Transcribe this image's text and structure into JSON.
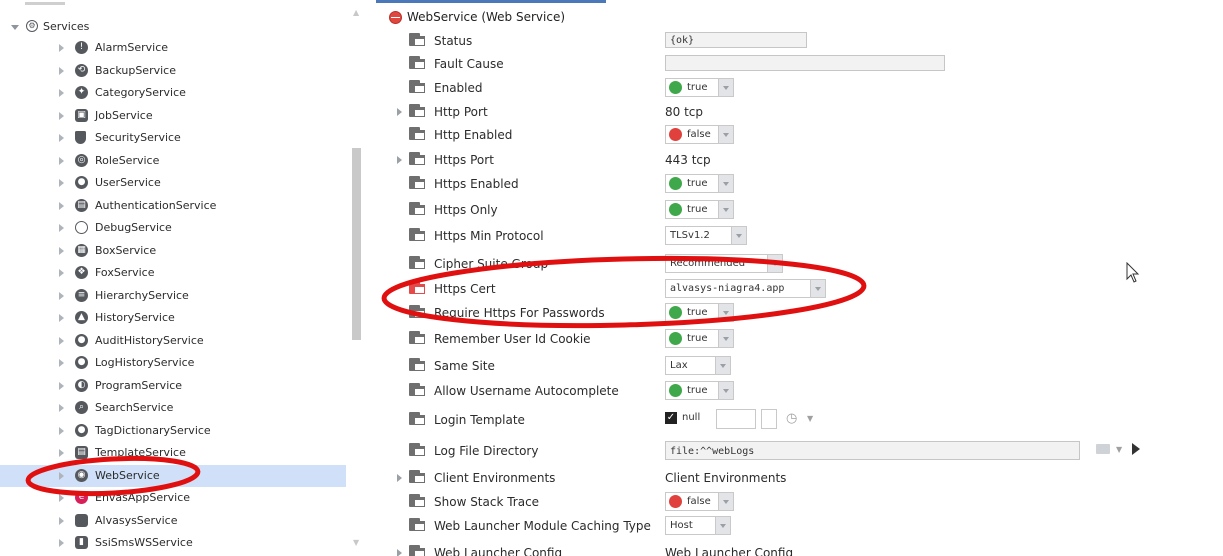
{
  "tree": {
    "root": {
      "label": "Services"
    },
    "items": [
      {
        "label": "AlarmService",
        "glyph": "!"
      },
      {
        "label": "BackupService",
        "glyph": "⟲"
      },
      {
        "label": "CategoryService",
        "glyph": "✦"
      },
      {
        "label": "JobService",
        "glyph": "▣"
      },
      {
        "label": "SecurityService",
        "glyph": ""
      },
      {
        "label": "RoleService",
        "glyph": "◎"
      },
      {
        "label": "UserService",
        "glyph": "●"
      },
      {
        "label": "AuthenticationService",
        "glyph": "▤"
      },
      {
        "label": "DebugService",
        "glyph": ""
      },
      {
        "label": "BoxService",
        "glyph": "▦"
      },
      {
        "label": "FoxService",
        "glyph": "❖"
      },
      {
        "label": "HierarchyService",
        "glyph": "≡"
      },
      {
        "label": "HistoryService",
        "glyph": "▲"
      },
      {
        "label": "AuditHistoryService",
        "glyph": "●"
      },
      {
        "label": "LogHistoryService",
        "glyph": "●"
      },
      {
        "label": "ProgramService",
        "glyph": "◐"
      },
      {
        "label": "SearchService",
        "glyph": "⌕"
      },
      {
        "label": "TagDictionaryService",
        "glyph": "●"
      },
      {
        "label": "TemplateService",
        "glyph": "▤"
      },
      {
        "label": "WebService",
        "glyph": "◉"
      },
      {
        "label": "EnvasAppService",
        "glyph": "e"
      },
      {
        "label": "AlvasysService",
        "glyph": ""
      },
      {
        "label": "SsiSmsWSService",
        "glyph": "▮"
      }
    ]
  },
  "sheet": {
    "title": "WebService  (Web Service)",
    "rows": [
      {
        "name": "Status",
        "value": "{ok}"
      },
      {
        "name": "Fault Cause",
        "value": ""
      },
      {
        "name": "Enabled",
        "value": "true"
      },
      {
        "name": "Http Port",
        "value": "80 tcp"
      },
      {
        "name": "Http Enabled",
        "value": "false"
      },
      {
        "name": "Https Port",
        "value": "443 tcp"
      },
      {
        "name": "Https Enabled",
        "value": "true"
      },
      {
        "name": "Https Only",
        "value": "true"
      },
      {
        "name": "Https Min Protocol",
        "value": "TLSv1.2"
      },
      {
        "name": "Cipher Suite Group",
        "value": "Recommended"
      },
      {
        "name": "Https Cert",
        "value": "alvasys-niagra4.app"
      },
      {
        "name": "Require Https For Passwords",
        "value": "true"
      },
      {
        "name": "Remember User Id Cookie",
        "value": "true"
      },
      {
        "name": "Same Site",
        "value": "Lax"
      },
      {
        "name": "Allow Username Autocomplete",
        "value": "true"
      },
      {
        "name": "Login Template",
        "value": "null"
      },
      {
        "name": "Log File Directory",
        "value": "file:^^webLogs"
      },
      {
        "name": "Client Environments",
        "value": "Client Environments"
      },
      {
        "name": "Show Stack Trace",
        "value": "false"
      },
      {
        "name": "Web Launcher Module Caching Type",
        "value": "Host"
      },
      {
        "name": "Web Launcher Config",
        "value": "Web Launcher Config"
      }
    ]
  },
  "colors": {
    "true_dot": "#3fa84a",
    "false_dot": "#e0413c",
    "selection": "#cfe0f8",
    "annotation": "#e01010"
  }
}
